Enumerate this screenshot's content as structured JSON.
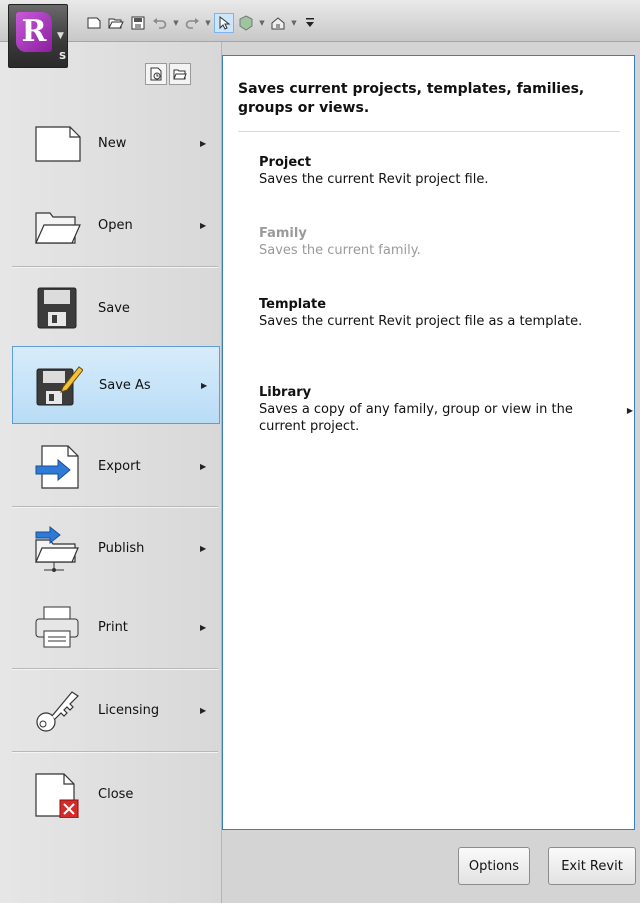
{
  "app_menu": {
    "logo_letter": "R",
    "shortcut_badge": "S"
  },
  "quick_access": {
    "icons": [
      "new-icon",
      "open-icon",
      "save-icon",
      "undo-icon",
      "redo-icon",
      "select-icon",
      "3d-view-icon",
      "home-view-icon",
      "customize-icon"
    ]
  },
  "menu": {
    "items": [
      {
        "id": "new",
        "label": "New",
        "has_submenu": true
      },
      {
        "id": "open",
        "label": "Open",
        "has_submenu": true
      },
      {
        "id": "save",
        "label": "Save",
        "has_submenu": false
      },
      {
        "id": "save_as",
        "label": "Save As",
        "has_submenu": true,
        "selected": true
      },
      {
        "id": "export",
        "label": "Export",
        "has_submenu": true
      },
      {
        "id": "publish",
        "label": "Publish",
        "has_submenu": true
      },
      {
        "id": "print",
        "label": "Print",
        "has_submenu": true
      },
      {
        "id": "licensing",
        "label": "Licensing",
        "has_submenu": true
      },
      {
        "id": "close",
        "label": "Close",
        "has_submenu": false
      }
    ]
  },
  "submenu": {
    "description": "Saves current projects, templates, families, groups or views.",
    "options": [
      {
        "title": "Project",
        "text": "Saves the current Revit project file.",
        "enabled": true
      },
      {
        "title": "Family",
        "text": "Saves the current family.",
        "enabled": false
      },
      {
        "title": "Template",
        "text": "Saves the current Revit project file as a template.",
        "enabled": true
      },
      {
        "title": "Library",
        "text": "Saves a copy of any family, group or view in the current project.",
        "enabled": true,
        "has_submenu": true
      }
    ]
  },
  "buttons": {
    "options": "Options",
    "exit": "Exit Revit"
  },
  "colors": {
    "selection_fill": "#c7e3f8",
    "selection_border": "#5d9ed8",
    "panel_border": "#3d7fbd",
    "disabled_text": "#9a9a9a",
    "close_red": "#d42a2a",
    "revit_purple": "#a23ab8"
  }
}
